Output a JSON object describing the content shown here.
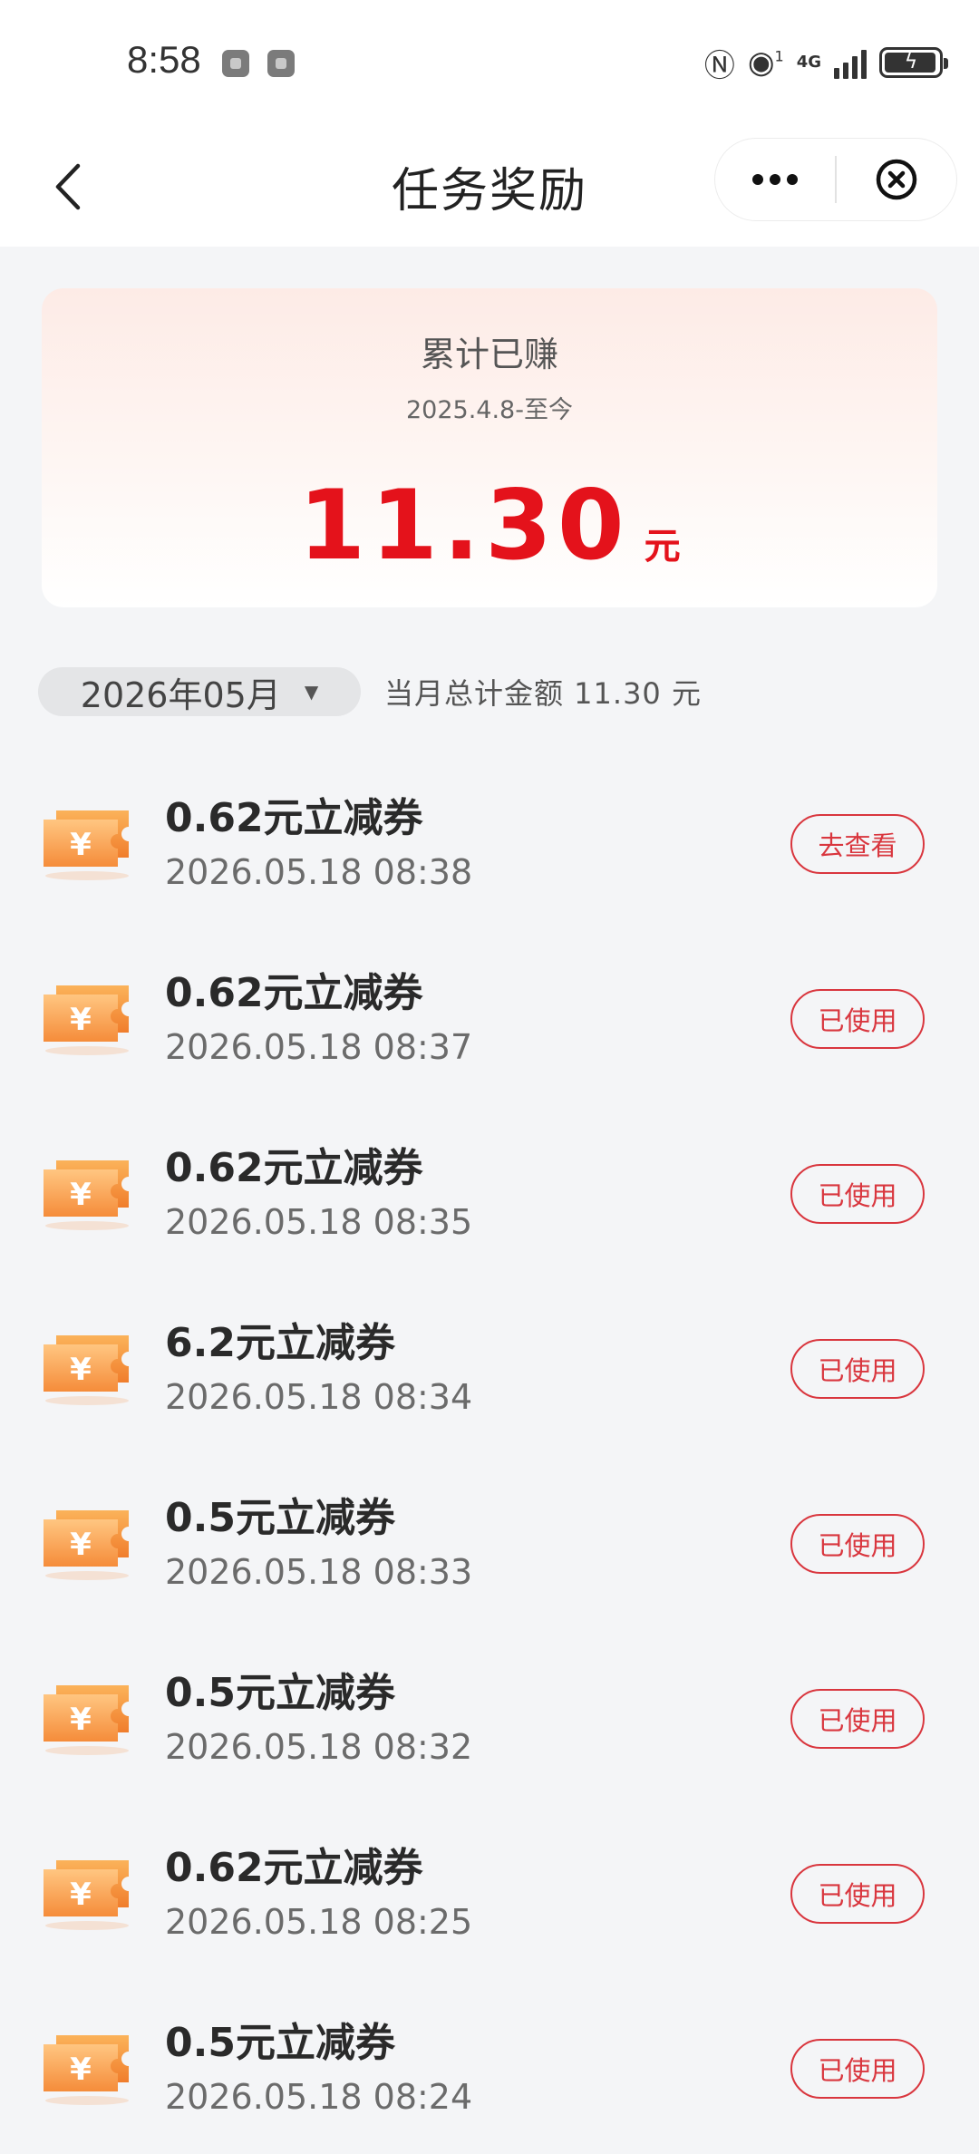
{
  "status_bar": {
    "time": "8:58",
    "network": "4G",
    "signal_badge": "1"
  },
  "nav": {
    "title": "任务奖励"
  },
  "summary": {
    "label": "累计已赚",
    "period": "2025.4.8-至今",
    "amount": "11.30",
    "unit": "元"
  },
  "filter": {
    "month": "2026年05月",
    "arrow": "▼",
    "total_text": "当月总计金额 11.30 元"
  },
  "rewards": [
    {
      "title": "0.62元立减券",
      "time": "2026.05.18 08:38",
      "action": "去查看"
    },
    {
      "title": "0.62元立减券",
      "time": "2026.05.18 08:37",
      "action": "已使用"
    },
    {
      "title": "0.62元立减券",
      "time": "2026.05.18 08:35",
      "action": "已使用"
    },
    {
      "title": "6.2元立减券",
      "time": "2026.05.18 08:34",
      "action": "已使用"
    },
    {
      "title": "0.5元立减券",
      "time": "2026.05.18 08:33",
      "action": "已使用"
    },
    {
      "title": "0.5元立减券",
      "time": "2026.05.18 08:32",
      "action": "已使用"
    },
    {
      "title": "0.62元立减券",
      "time": "2026.05.18 08:25",
      "action": "已使用"
    },
    {
      "title": "0.5元立减券",
      "time": "2026.05.18 08:24",
      "action": "已使用"
    }
  ],
  "colors": {
    "accent_red": "#e4121b",
    "button_red": "#d9363e",
    "coupon_orange": "#f59a43"
  },
  "icons": {
    "coupon": "yuan-coupon-icon",
    "back": "chevron-left-icon",
    "more": "more-dots-icon",
    "close": "close-circle-icon"
  }
}
